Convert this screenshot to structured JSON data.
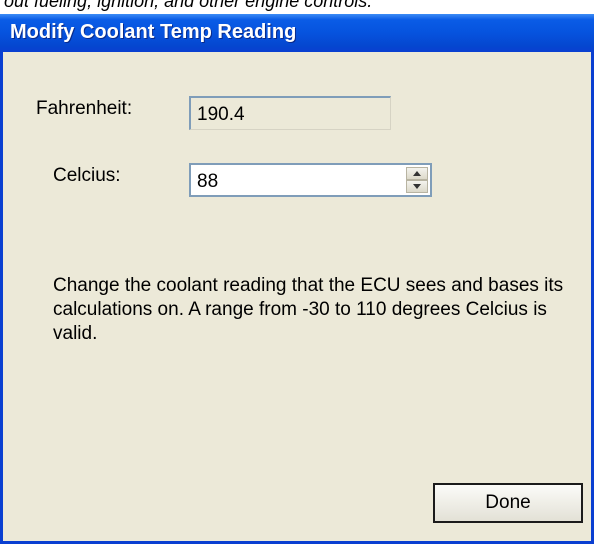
{
  "background_caption": "out fueling, ignition, and other engine controls.",
  "dialog": {
    "title": "Modify Coolant Temp Reading",
    "fahrenheit_label": "Fahrenheit:",
    "fahrenheit_value": "190.4",
    "celcius_label": "Celcius:",
    "celcius_value": "88",
    "description": "Change the coolant reading that the ECU sees and bases its calculations on.  A range from -30 to 110 degrees Celcius is valid.",
    "done_label": "Done"
  },
  "colors": {
    "titlebar": "#0653de",
    "window_bg": "#ece9d8",
    "frame": "#0a3fd1"
  },
  "icons": {
    "spin_up": "spin-up-arrow-icon",
    "spin_down": "spin-down-arrow-icon"
  }
}
